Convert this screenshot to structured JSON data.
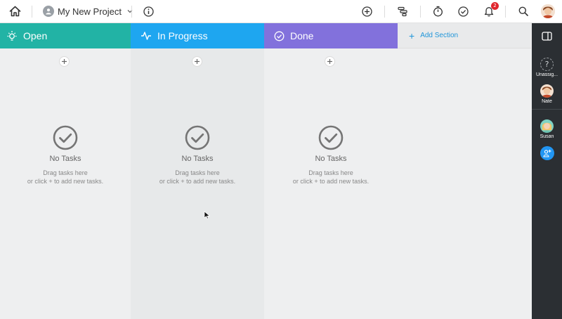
{
  "header": {
    "project_name": "My New Project",
    "notification_count": "2",
    "icons": [
      "home-icon",
      "project-avatar-icon",
      "chevron-down-icon",
      "info-icon",
      "add-icon",
      "timeline-icon",
      "timer-icon",
      "check-circle-icon",
      "bell-icon",
      "search-icon",
      "user-avatar"
    ]
  },
  "columns": [
    {
      "title": "Open",
      "color": "#22b3a5",
      "icon": "lightbulb-icon",
      "empty_title": "No Tasks",
      "empty_line1": "Drag tasks here",
      "empty_line2": "or click + to add new tasks."
    },
    {
      "title": "In Progress",
      "color": "#1ea6f0",
      "icon": "activity-icon",
      "empty_title": "No Tasks",
      "empty_line1": "Drag tasks here",
      "empty_line2": "or click + to add new tasks."
    },
    {
      "title": "Done",
      "color": "#8271dc",
      "icon": "check-circle-icon",
      "empty_title": "No Tasks",
      "empty_line1": "Drag tasks here",
      "empty_line2": "or click + to add new tasks."
    }
  ],
  "add_section": {
    "label": "Add Section",
    "color": "#2196d9"
  },
  "sidebar": {
    "members": [
      {
        "label": "Unassig...",
        "icon": "question-mark-icon"
      },
      {
        "label": "Nate",
        "icon": "avatar-nate"
      },
      {
        "label": "Susan",
        "icon": "avatar-susan"
      }
    ],
    "icons": [
      "panel-toggle-icon",
      "add-member-icon"
    ]
  },
  "colors": {
    "background": "#eeeff0",
    "sidebar": "#2b2f33",
    "accent": "#2196f3",
    "badge": "#e0262d"
  }
}
